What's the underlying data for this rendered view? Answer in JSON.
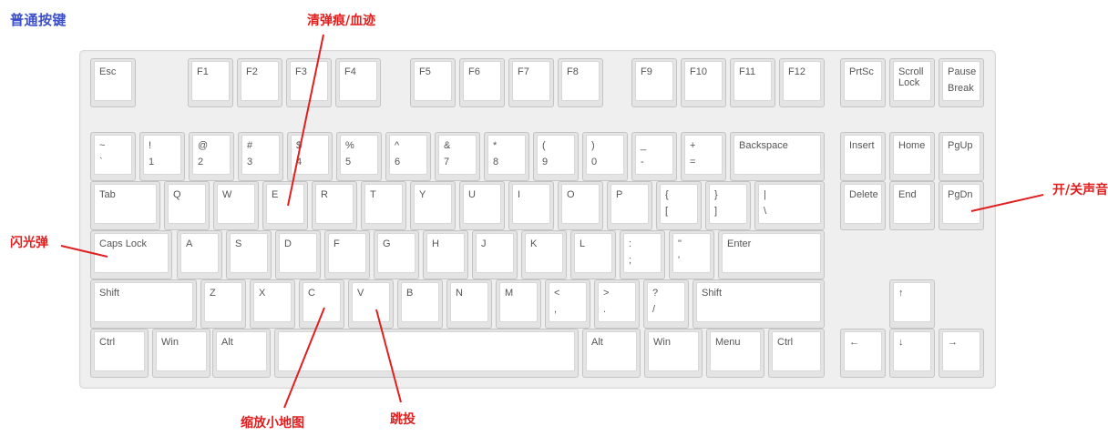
{
  "header": {
    "title": "普通按键"
  },
  "annotations": {
    "cleanup": "清弹痕/血迹",
    "sound": "开/关声音",
    "flash": "闪光弹",
    "minimap": "缩放小地图",
    "jumpthrow": "跳投"
  },
  "keyboard": {
    "keys": {
      "esc": {
        "top": "Esc"
      },
      "f1": {
        "top": "F1"
      },
      "f2": {
        "top": "F2"
      },
      "f3": {
        "top": "F3"
      },
      "f4": {
        "top": "F4"
      },
      "f5": {
        "top": "F5"
      },
      "f6": {
        "top": "F6"
      },
      "f7": {
        "top": "F7"
      },
      "f8": {
        "top": "F8"
      },
      "f9": {
        "top": "F9"
      },
      "f10": {
        "top": "F10"
      },
      "f11": {
        "top": "F11"
      },
      "f12": {
        "top": "F12"
      },
      "prtsc": {
        "top": "PrtSc"
      },
      "scroll": {
        "top": "Scroll",
        "mid": "Lock"
      },
      "pause": {
        "top": "Pause",
        "bottom": "Break"
      },
      "tilde": {
        "top": "~",
        "bottom": "`"
      },
      "d1": {
        "top": "!",
        "bottom": "1"
      },
      "d2": {
        "top": "@",
        "bottom": "2"
      },
      "d3": {
        "top": "#",
        "bottom": "3"
      },
      "d4": {
        "top": "$",
        "bottom": "4"
      },
      "d5": {
        "top": "%",
        "bottom": "5"
      },
      "d6": {
        "top": "^",
        "bottom": "6"
      },
      "d7": {
        "top": "&",
        "bottom": "7"
      },
      "d8": {
        "top": "*",
        "bottom": "8"
      },
      "d9": {
        "top": "(",
        "bottom": "9"
      },
      "d0": {
        "top": ")",
        "bottom": "0"
      },
      "minus": {
        "top": "_",
        "bottom": "-"
      },
      "equal": {
        "top": "+",
        "bottom": "="
      },
      "backspace": {
        "top": "Backspace"
      },
      "insert": {
        "top": "Insert"
      },
      "home": {
        "top": "Home"
      },
      "pgup": {
        "top": "PgUp"
      },
      "tab": {
        "top": "Tab"
      },
      "q": {
        "top": "Q"
      },
      "w": {
        "top": "W"
      },
      "e": {
        "top": "E"
      },
      "r": {
        "top": "R"
      },
      "tk": {
        "top": "T"
      },
      "y": {
        "top": "Y"
      },
      "u": {
        "top": "U"
      },
      "i": {
        "top": "I"
      },
      "o": {
        "top": "O"
      },
      "p": {
        "top": "P"
      },
      "lbrace": {
        "top": "{",
        "bottom": "["
      },
      "rbrace": {
        "top": "}",
        "bottom": "]"
      },
      "pipe": {
        "top": "|",
        "bottom": "\\"
      },
      "delete": {
        "top": "Delete"
      },
      "end": {
        "top": "End"
      },
      "pgdn": {
        "top": "PgDn"
      },
      "caps": {
        "top": "Caps Lock"
      },
      "a": {
        "top": "A"
      },
      "s": {
        "top": "S"
      },
      "d": {
        "top": "D"
      },
      "f": {
        "top": "F"
      },
      "g": {
        "top": "G"
      },
      "h": {
        "top": "H"
      },
      "j": {
        "top": "J"
      },
      "k": {
        "top": "K"
      },
      "lk": {
        "top": "L"
      },
      "colon": {
        "top": ":",
        "bottom": ";"
      },
      "quote": {
        "top": "\"",
        "bottom": "'"
      },
      "enter": {
        "top": "Enter"
      },
      "lshift": {
        "top": "Shift"
      },
      "z": {
        "top": "Z"
      },
      "x": {
        "top": "X"
      },
      "c": {
        "top": "C"
      },
      "v": {
        "top": "V"
      },
      "bk": {
        "top": "B"
      },
      "n": {
        "top": "N"
      },
      "mk": {
        "top": "M"
      },
      "lt": {
        "top": "<",
        "bottom": ","
      },
      "gt": {
        "top": ">",
        "bottom": "."
      },
      "qm": {
        "top": "?",
        "bottom": "/"
      },
      "rshift": {
        "top": "Shift"
      },
      "up": {
        "top": "↑"
      },
      "lctrl": {
        "top": "Ctrl"
      },
      "lwin": {
        "top": "Win"
      },
      "lalt": {
        "top": "Alt"
      },
      "space": {
        "top": ""
      },
      "ralt": {
        "top": "Alt"
      },
      "rwin": {
        "top": "Win"
      },
      "menu": {
        "top": "Menu"
      },
      "rctrl": {
        "top": "Ctrl"
      },
      "left": {
        "top": "←"
      },
      "down": {
        "top": "↓"
      },
      "right": {
        "top": "→"
      }
    }
  }
}
